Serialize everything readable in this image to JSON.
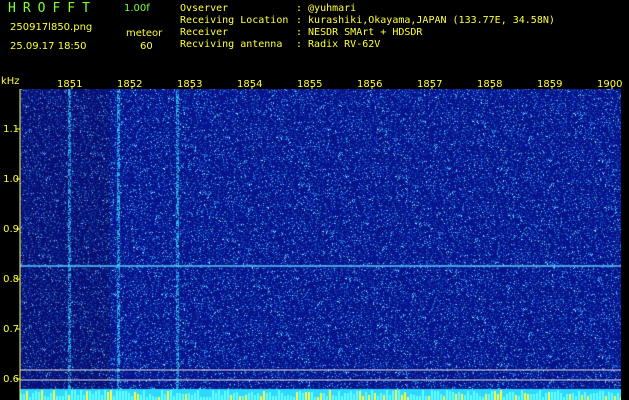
{
  "header": {
    "brand": "HROFFT",
    "version": "1.00f",
    "filename": "250917l850.png",
    "datetime": "25.09.17 18:50",
    "mode_label": "meteor",
    "mode_value": "60",
    "info": [
      {
        "label": "Ovserver",
        "value": ": @yuhmari"
      },
      {
        "label": "Receiving Location",
        "value": ": kurashiki,Okayama,JAPAN (133.77E, 34.58N)"
      },
      {
        "label": "Receiver",
        "value": ": NESDR SMArt + HDSDR"
      },
      {
        "label": "Recviving antenna",
        "value": ": Radix RV-62V"
      }
    ]
  },
  "axes": {
    "y_unit": "kHz",
    "y_ticks": [
      "1.1",
      "1.0",
      "0.9",
      "0.8",
      "0.7",
      "0.6"
    ],
    "x_ticks": [
      "1851",
      "1852",
      "1853",
      "1854",
      "1855",
      "1856",
      "1857",
      "1858",
      "1859",
      "1900"
    ]
  },
  "colors": {
    "background": "#000000",
    "spectrogram_base": "#0a1a8a",
    "text_green": "#7cff3a",
    "text_yellow": "#ffff3a",
    "label_white": "#ffffff"
  }
}
